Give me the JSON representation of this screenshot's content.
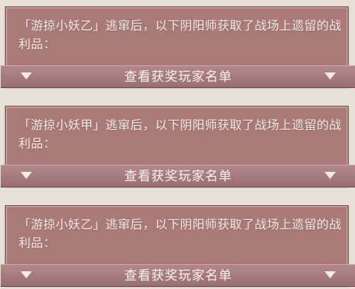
{
  "panels": [
    {
      "message": "「游掠小妖乙」逃窜后，以下阴阳师获取了战场上遗留的战利品：",
      "button_label": "查看获奖玩家名单"
    },
    {
      "message": "「游掠小妖甲」逃窜后，以下阴阳师获取了战场上遗留的战利品：",
      "button_label": "查看获奖玩家名单"
    },
    {
      "message": "「游掠小妖乙」逃窜后，以下阴阳师获取了战场上遗留的战利品：",
      "button_label": "查看获奖玩家名单"
    }
  ],
  "icons": {
    "expand": "chevron-down-icon"
  }
}
